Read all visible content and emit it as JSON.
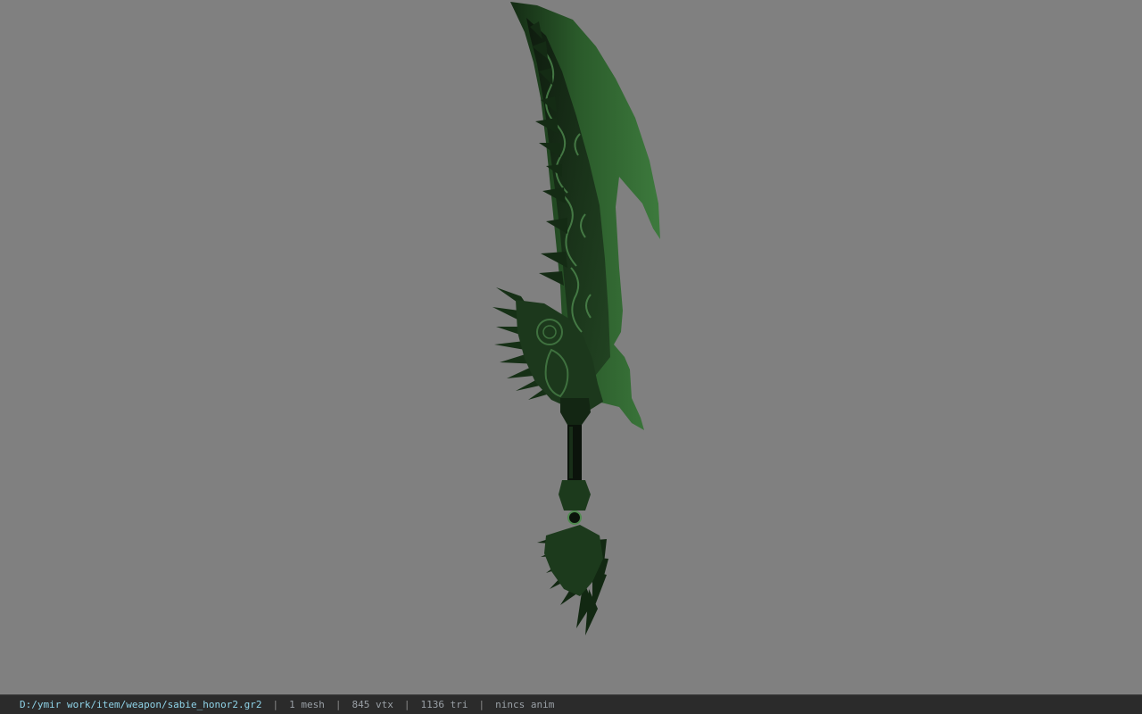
{
  "viewer": {
    "background_color": "#808080",
    "model_color": "#1f4a1f",
    "model_name": "weapon model (sword)"
  },
  "statusbar": {
    "file_path": "D:/ymir work/item/weapon/sabie_honor2.gr2",
    "separator": "|",
    "mesh_count": "1 mesh",
    "vertex_count": "845 vtx",
    "triangle_count": "1136 tri",
    "anim_status": "nincs anim",
    "path_color": "#8fd3e8",
    "bar_color": "#2b2b2b"
  }
}
